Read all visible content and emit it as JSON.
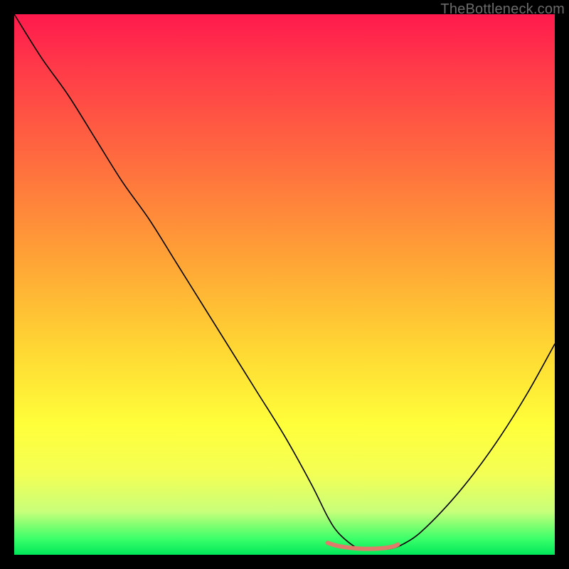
{
  "watermark": "TheBottleneck.com",
  "chart_data": {
    "type": "line",
    "title": "",
    "xlabel": "",
    "ylabel": "",
    "xlim": [
      0,
      100
    ],
    "ylim": [
      0,
      100
    ],
    "grid": false,
    "series": [
      {
        "name": "bottleneck-curve",
        "color": "#000000",
        "stroke_width": 1.6,
        "x": [
          0,
          5,
          10,
          15,
          20,
          25,
          30,
          35,
          40,
          45,
          50,
          55,
          58,
          60,
          63,
          65,
          68,
          70,
          72,
          75,
          80,
          85,
          90,
          95,
          100
        ],
        "y": [
          100,
          92,
          85,
          77,
          69,
          62,
          54,
          46,
          38,
          30,
          22,
          13,
          7,
          4,
          1.5,
          1,
          1,
          1.2,
          2,
          4,
          9,
          15,
          22,
          30,
          39
        ]
      },
      {
        "name": "optimal-band",
        "color": "#e07a6a",
        "stroke_width": 6,
        "x": [
          58,
          60,
          63,
          65,
          68,
          70,
          71
        ],
        "y": [
          2.2,
          1.6,
          1.2,
          1.1,
          1.2,
          1.5,
          1.9
        ]
      }
    ]
  }
}
